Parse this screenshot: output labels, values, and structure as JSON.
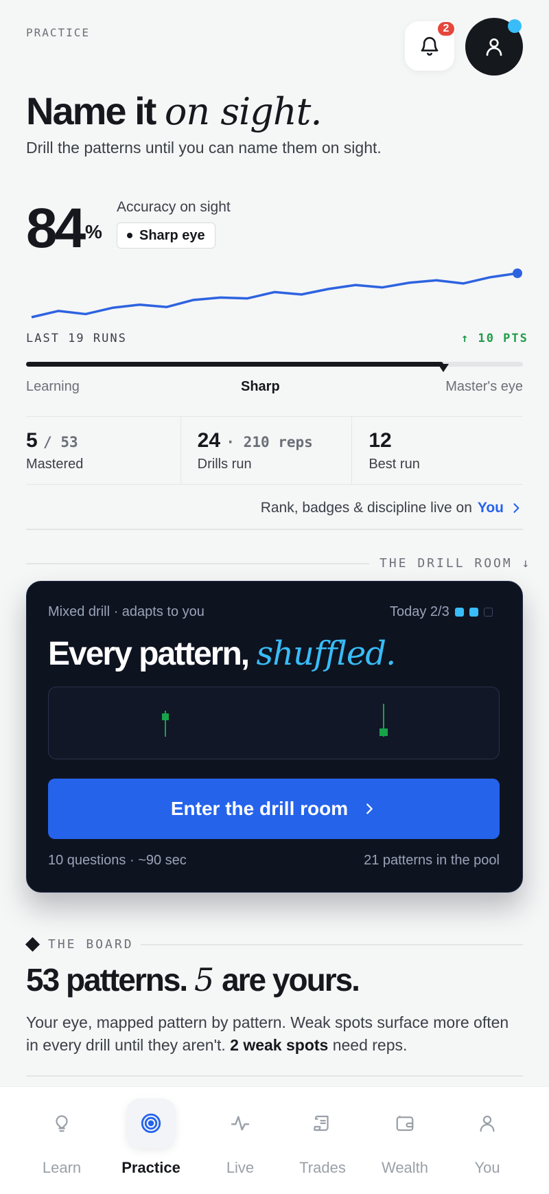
{
  "header": {
    "eyebrow": "PRACTICE",
    "notification_count": "2"
  },
  "hero": {
    "title_bold": "Name it",
    "title_italic": "on sight.",
    "subtitle": "Drill the patterns until you can name them on sight."
  },
  "accuracy": {
    "value": "84",
    "unit": "%",
    "label": "Accuracy on sight",
    "chip": "Sharp eye"
  },
  "sparkline": {
    "points": [
      12,
      20,
      16,
      24,
      28,
      25,
      34,
      37,
      36,
      44,
      41,
      48,
      53,
      50,
      56,
      59,
      55,
      63,
      68
    ],
    "runs_label": "LAST 19 RUNS",
    "delta_label": "↑ 10 PTS",
    "color": "#2d63e0"
  },
  "level": {
    "progress": 0.84,
    "left": "Learning",
    "middle": "Sharp",
    "right": "Master's eye"
  },
  "stats": [
    {
      "value": "5",
      "secondary": "/ 53",
      "label": "Mastered"
    },
    {
      "value": "24",
      "secondary": "· 210 reps",
      "label": "Drills run"
    },
    {
      "value": "12",
      "secondary": "",
      "label": "Best run"
    }
  ],
  "rank_link": {
    "text": "Rank, badges & discipline live on",
    "link": "You"
  },
  "drill_room": {
    "section_label": "THE DRILL ROOM ↓",
    "meta": "Mixed drill · adapts to you",
    "today": "Today 2/3",
    "title_bold": "Every pattern,",
    "title_italic": "shuffled.",
    "cta": "Enter the drill room",
    "footer_left": "10 questions · ~90 sec",
    "footer_right": "21 patterns in the pool",
    "accent": "#38bdf8",
    "button_color": "#2563eb"
  },
  "board": {
    "section_label": "THE BOARD",
    "title_a": "53 patterns.",
    "title_num": "5",
    "title_b": "are yours.",
    "text_a": "Your eye, mapped pattern by pattern. Weak spots surface more often in every drill until they aren't.",
    "text_bold": "2 weak spots",
    "text_b": "need reps."
  },
  "nav": {
    "items": [
      "Learn",
      "Practice",
      "Live",
      "Trades",
      "Wealth",
      "You"
    ],
    "active": "Practice"
  }
}
